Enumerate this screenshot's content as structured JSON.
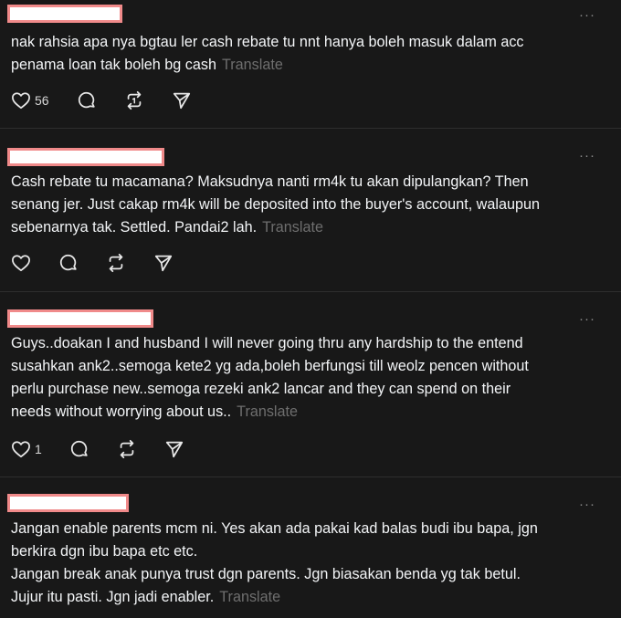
{
  "colors": {
    "background": "#181818",
    "divider": "#2e2e2e",
    "text": "#f3f5f7",
    "muted": "#6e6e6e",
    "redaction_fill": "#ffffff",
    "redaction_border": "#f08a8a"
  },
  "translate_label": "Translate",
  "more_label": "···",
  "posts": [
    {
      "lines": [
        "nak rahsia apa nya bgtau ler cash rebate tu nnt hanya boleh masuk dalam acc",
        "penama loan tak boleh bg cash"
      ],
      "like_count": "56"
    },
    {
      "lines": [
        "Cash rebate tu macamana? Maksudnya nanti rm4k tu akan dipulangkan? Then",
        "senang jer. Just cakap rm4k will be deposited into the buyer's account, walaupun",
        "sebenarnya tak. Settled. Pandai2 lah."
      ],
      "like_count": ""
    },
    {
      "lines": [
        "Guys..doakan I and husband I will never going thru any hardship to the entend",
        "susahkan ank2..semoga kete2 yg ada,boleh berfungsi till weolz pencen without",
        "perlu purchase new..semoga rezeki ank2 lancar and they can spend on their",
        "needs without worrying about us.."
      ],
      "like_count": "1"
    },
    {
      "lines": [
        "Jangan enable parents mcm ni. Yes akan ada pakai kad balas budi ibu bapa, jgn",
        "berkira dgn ibu bapa etc etc.",
        "Jangan break anak punya trust dgn parents. Jgn biasakan benda yg tak betul.",
        "Jujur itu pasti. Jgn jadi enabler."
      ],
      "like_count": ""
    }
  ],
  "icons": [
    "heart-icon",
    "comment-icon",
    "repost-icon",
    "share-icon",
    "more-icon"
  ]
}
